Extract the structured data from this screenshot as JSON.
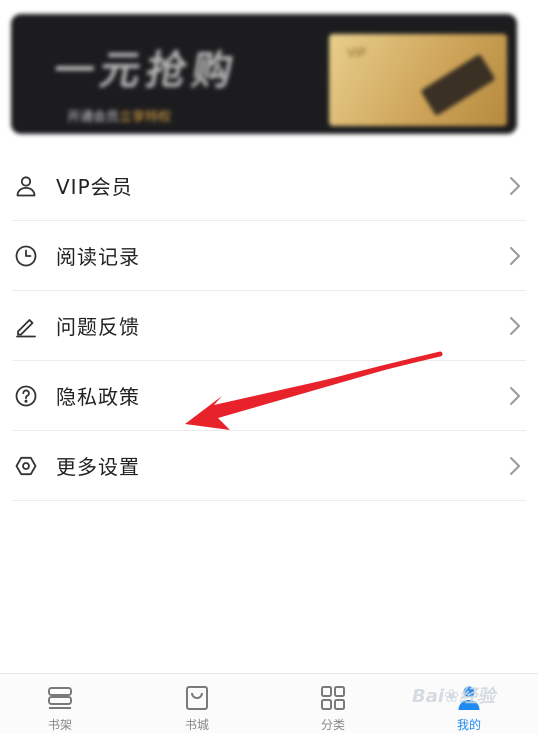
{
  "banner": {
    "title": "一元抢购",
    "subtitle_prefix": "开通会员",
    "subtitle_highlight": "立享特权",
    "card_label": "VIP"
  },
  "menu": {
    "items": [
      {
        "label": "VIP会员",
        "icon": "user-icon"
      },
      {
        "label": "阅读记录",
        "icon": "clock-icon"
      },
      {
        "label": "问题反馈",
        "icon": "pencil-icon"
      },
      {
        "label": "隐私政策",
        "icon": "help-circle-icon"
      },
      {
        "label": "更多设置",
        "icon": "settings-hexagon-icon"
      }
    ]
  },
  "bottom_nav": {
    "active_color": "#1f8bf0",
    "tabs": [
      {
        "label": "书架",
        "icon": "bookshelf-icon"
      },
      {
        "label": "书城",
        "icon": "shopping-bag-icon"
      },
      {
        "label": "分类",
        "icon": "grid-icon"
      },
      {
        "label": "我的",
        "icon": "profile-icon"
      }
    ]
  },
  "annotation": {
    "arrow_color": "#e8222a"
  },
  "watermark": "Bai❀经验"
}
